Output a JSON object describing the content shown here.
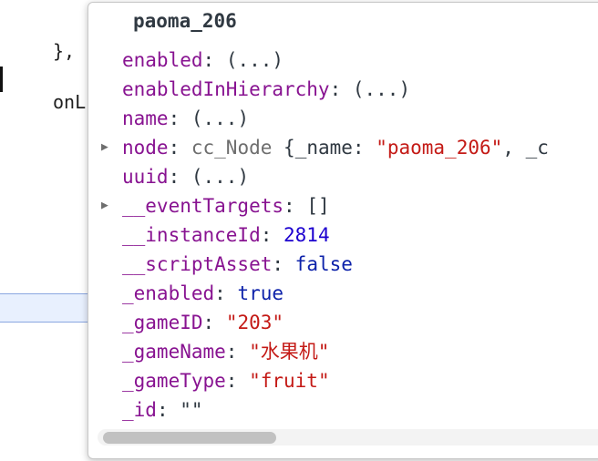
{
  "background": {
    "line1": "},",
    "line2": "onL"
  },
  "popover": {
    "title": "paoma_206",
    "rows": [
      {
        "key": "enabled",
        "value": "(...)"
      },
      {
        "key": "enabledInHierarchy",
        "value": "(...)"
      },
      {
        "key": "name",
        "value": "(...)"
      },
      {
        "key": "node",
        "class_name": "cc_Node",
        "preview_open": "{_name: ",
        "preview_string": "\"paoma_206\"",
        "preview_rest": ", _c",
        "expandable": true
      },
      {
        "key": "uuid",
        "value": "(...)"
      },
      {
        "key": "__eventTargets",
        "value": "[]",
        "expandable": true
      },
      {
        "key": "__instanceId",
        "value": "2814"
      },
      {
        "key": "__scriptAsset",
        "value": "false"
      },
      {
        "key": "_enabled",
        "value": "true"
      },
      {
        "key": "_gameID",
        "value": "\"203\""
      },
      {
        "key": "_gameName",
        "value": "\"水果机\""
      },
      {
        "key": "_gameType",
        "value": "\"fruit\""
      },
      {
        "key": "_id",
        "value": "\"\""
      }
    ],
    "expand_icon": "triangle-right-icon"
  },
  "colors": {
    "property_key": "#881391",
    "string_value": "#c41a16",
    "number_value": "#1c00cf",
    "boolean_value": "#0d22aa",
    "class_name": "#6e6e6e"
  }
}
